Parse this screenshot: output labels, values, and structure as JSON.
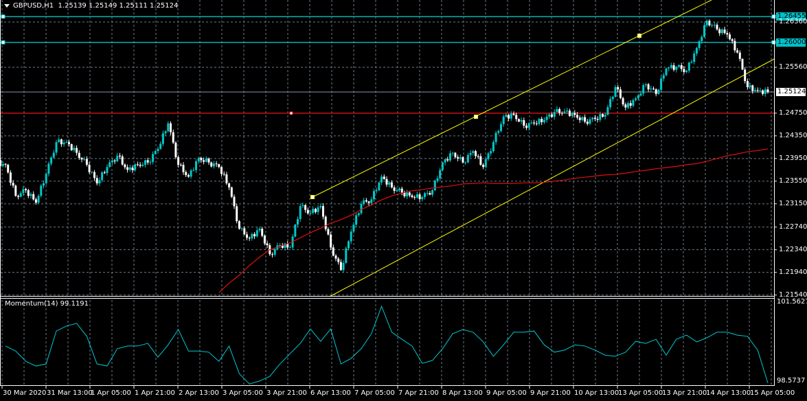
{
  "header": {
    "symbol": "GBPUSD,H1",
    "ohlc": "1.25139 1.25149 1.25111 1.25124"
  },
  "indicator": {
    "title": "Momentum(14) 99.1191",
    "max_label": "101.5627",
    "min_label": "98.5737"
  },
  "colors": {
    "background": "#000000",
    "bull": "#00c8c8",
    "bear": "#ffffff",
    "moving_average": "#e01010",
    "channel": "#ffff00",
    "hline": "#00c0c8",
    "resistance": "#e01010",
    "grid": "#6e7b8b",
    "momentum": "#00c8d0"
  },
  "levels": {
    "hline_1": {
      "price": 1.26455,
      "label": "1.26455"
    },
    "hline_2": {
      "price": 1.26,
      "label": "1.26000"
    },
    "bid": {
      "price": 1.25124,
      "label": "1.25124"
    },
    "red_hline": {
      "price": 1.2475
    }
  },
  "price_axis": [
    "1.26360",
    "1.25560",
    "1.24750",
    "1.24350",
    "1.23950",
    "1.23550",
    "1.23150",
    "1.22740",
    "1.22340",
    "1.21940",
    "1.21540"
  ],
  "time_axis": [
    "30 Mar 2020",
    "31 Mar 13:00",
    "1 Apr 05:00",
    "1 Apr 21:00",
    "2 Apr 13:00",
    "3 Apr 05:00",
    "3 Apr 21:00",
    "6 Apr 13:00",
    "7 Apr 05:00",
    "7 Apr 21:00",
    "8 Apr 13:00",
    "9 Apr 05:00",
    "9 Apr 21:00",
    "10 Apr 13:00",
    "13 Apr 05:00",
    "13 Apr 21:00",
    "14 Apr 13:00",
    "15 Apr 05:00"
  ],
  "chart_data": {
    "type": "candlestick",
    "symbol": "GBPUSD",
    "timeframe": "H1",
    "ylim": [
      1.2154,
      1.265
    ],
    "grid": true,
    "close": [
      1.2384,
      1.2329,
      1.2339,
      1.2317,
      1.2368,
      1.2424,
      1.2424,
      1.2405,
      1.2384,
      1.2351,
      1.238,
      1.24,
      1.2375,
      1.2384,
      1.2388,
      1.2412,
      1.2457,
      1.2384,
      1.2363,
      1.2396,
      1.2388,
      1.238,
      1.2344,
      1.2271,
      1.2254,
      1.2271,
      1.2226,
      1.2242,
      1.2238,
      1.2311,
      1.2299,
      1.2311,
      1.2238,
      1.2198,
      1.2266,
      1.2315,
      1.2323,
      1.2363,
      1.2344,
      1.2335,
      1.2327,
      1.2327,
      1.2339,
      1.2388,
      1.2405,
      1.2388,
      1.2408,
      1.238,
      1.2424,
      1.2469,
      1.2472,
      1.2453,
      1.2457,
      1.2463,
      1.2477,
      1.2478,
      1.2472,
      1.246,
      1.2465,
      1.2472,
      1.2521,
      1.2485,
      1.2501,
      1.2526,
      1.2509,
      1.2554,
      1.2557,
      1.255,
      1.259,
      1.2638,
      1.2623,
      1.2614,
      1.2582,
      1.2521,
      1.2515,
      1.25124
    ],
    "moving_average": [
      null,
      null,
      null,
      null,
      null,
      null,
      null,
      null,
      null,
      null,
      null,
      null,
      null,
      null,
      null,
      null,
      null,
      null,
      null,
      null,
      null,
      1.2158,
      1.2175,
      1.2189,
      1.2206,
      1.2221,
      1.2234,
      1.224,
      1.2246,
      1.2255,
      1.2264,
      1.2272,
      1.2281,
      1.2287,
      1.2295,
      1.2305,
      1.2313,
      1.2322,
      1.2329,
      1.2334,
      1.2338,
      1.234,
      1.2343,
      1.2345,
      1.2347,
      1.235,
      1.2351,
      1.2352,
      1.2351,
      1.2351,
      1.2351,
      1.2352,
      1.2352,
      1.2353,
      1.2355,
      1.2357,
      1.236,
      1.2362,
      1.2364,
      1.2366,
      1.2367,
      1.2369,
      1.2372,
      1.2374,
      1.2377,
      1.2379,
      1.2381,
      1.2384,
      1.2386,
      1.239,
      1.2395,
      1.24,
      1.2403,
      1.2407,
      1.2409,
      1.2412
    ],
    "momentum": {
      "name": "Momentum(14)",
      "ylim": [
        98.5737,
        101.5627
      ],
      "values": [
        100.07,
        99.9,
        99.55,
        99.39,
        99.46,
        100.58,
        100.75,
        100.84,
        100.4,
        99.46,
        99.39,
        99.98,
        100.07,
        100.07,
        100.16,
        99.69,
        100.11,
        100.63,
        99.9,
        99.9,
        99.86,
        99.55,
        100.07,
        99.13,
        98.78,
        98.88,
        99.04,
        99.46,
        99.81,
        100.16,
        100.65,
        100.23,
        100.65,
        99.46,
        99.65,
        99.98,
        100.49,
        101.42,
        100.54,
        100.3,
        100.07,
        99.48,
        99.58,
        99.98,
        100.49,
        100.63,
        100.54,
        100.21,
        99.72,
        100.11,
        100.54,
        100.54,
        100.58,
        100.11,
        99.86,
        99.93,
        100.11,
        100.07,
        99.93,
        99.76,
        99.72,
        99.86,
        100.23,
        100.16,
        100.3,
        99.76,
        100.3,
        100.44,
        100.21,
        100.35,
        100.54,
        100.54,
        100.44,
        100.4,
        99.93,
        98.81
      ]
    }
  }
}
